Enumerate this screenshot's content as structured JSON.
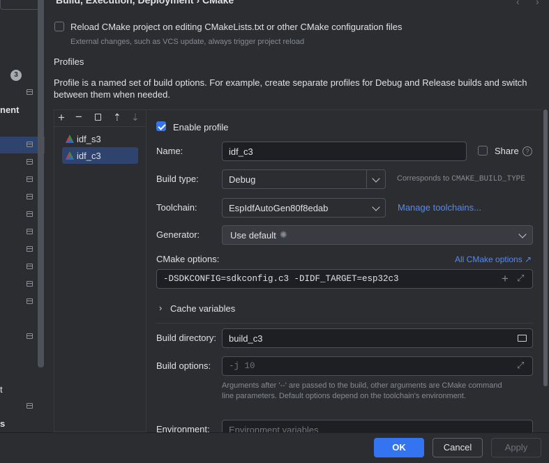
{
  "header": {
    "breadcrumb": "Build, Execution, Deployment  ›  CMake"
  },
  "sidebar": {
    "badge": "3",
    "partial_labels": [
      "nent",
      "t",
      "s"
    ]
  },
  "reload": {
    "label": "Reload CMake project on editing CMakeLists.txt or other CMake configuration files",
    "hint": "External changes, such as VCS update, always trigger project reload",
    "checked": false
  },
  "profiles": {
    "title": "Profiles",
    "description": "Profile is a named set of build options. For example, create separate profiles for Debug and Release builds and switch between them when needed.",
    "items": [
      {
        "name": "idf_s3",
        "selected": false
      },
      {
        "name": "idf_c3",
        "selected": true
      }
    ]
  },
  "form": {
    "enable_label": "Enable profile",
    "enabled": true,
    "name_label": "Name:",
    "name_value": "idf_c3",
    "share_label": "Share",
    "build_type_label": "Build type:",
    "build_type_value": "Debug",
    "build_type_hint_prefix": "Corresponds to ",
    "build_type_hint_code": "CMAKE_BUILD_TYPE",
    "toolchain_label": "Toolchain:",
    "toolchain_value": "EspIdfAutoGen80f8edab",
    "manage_toolchains": "Manage toolchains...",
    "generator_label": "Generator:",
    "generator_value": "Use default",
    "cmake_options_label": "CMake options:",
    "all_cmake_options": "All CMake options ↗",
    "cmake_options_value": "-DSDKCONFIG=sdkconfig.c3 -DIDF_TARGET=esp32c3",
    "cache_variables": "Cache variables",
    "build_dir_label": "Build directory:",
    "build_dir_value": "build_c3",
    "build_options_label": "Build options:",
    "build_options_placeholder": "-j 10",
    "build_options_hint": "Arguments after '--' are passed to the build, other arguments are CMake command line parameters. Default options depend on the toolchain's environment.",
    "environment_label": "Environment:",
    "environment_placeholder": "Environment variables"
  },
  "buttons": {
    "ok": "OK",
    "cancel": "Cancel",
    "apply": "Apply"
  },
  "colors": {
    "accent": "#3574f0",
    "link": "#548af7",
    "background": "#2b2d30",
    "field": "#1e1f22"
  }
}
